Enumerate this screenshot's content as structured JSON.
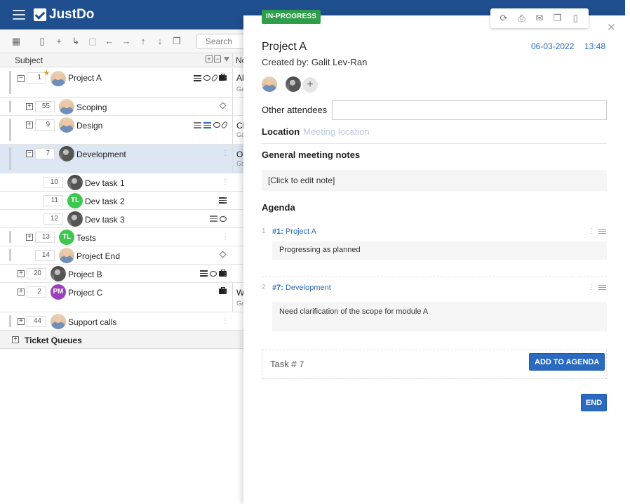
{
  "app": {
    "name": "JustDo"
  },
  "toolbar": {
    "search_placeholder": "Search"
  },
  "grid": {
    "header": {
      "subject": "Subject",
      "col2": "No"
    },
    "rows": [
      {
        "seq": "1",
        "title": "Project A",
        "col2_a": "Al",
        "col2_b": "Ga"
      },
      {
        "seq": "55",
        "title": "Scoping"
      },
      {
        "seq": "9",
        "title": "Design",
        "col2_a": "Cl",
        "col2_b": "Ga"
      },
      {
        "seq": "7",
        "title": "Development",
        "col2_a": "Oi",
        "col2_b": "Ga"
      },
      {
        "seq": "10",
        "title": "Dev task 1"
      },
      {
        "seq": "11",
        "title": "Dev task 2",
        "avatar": "TL"
      },
      {
        "seq": "12",
        "title": "Dev task 3"
      },
      {
        "seq": "13",
        "title": "Tests",
        "avatar": "TL"
      },
      {
        "seq": "14",
        "title": "Project End"
      },
      {
        "seq": "20",
        "title": "Project B"
      },
      {
        "seq": "2",
        "title": "Project C",
        "avatar": "PM",
        "col2_a": "W",
        "col2_b": "Ga"
      },
      {
        "seq": "44",
        "title": "Support calls"
      }
    ],
    "ticket_queues": "Ticket Queues"
  },
  "panel": {
    "status": "IN-PROGRESS",
    "title": "Project A",
    "date": "06-03-2022",
    "time": "13:48",
    "created_by": "Created by: Galit Lev-Ran",
    "other_attendees_label": "Other attendees",
    "location_label": "Location",
    "location_placeholder": "Meeting location",
    "notes_label": "General meeting notes",
    "notes_value": "[Click to edit note]",
    "agenda_label": "Agenda",
    "agenda": [
      {
        "num": "1",
        "task_num": "#1:",
        "task_name": "Project A",
        "note": "Progressing as planned"
      },
      {
        "num": "2",
        "task_num": "#7:",
        "task_name": "Development",
        "note": "Need clarification of the scope for module A"
      }
    ],
    "add_task_label": "Task #",
    "add_task_value": "7",
    "add_button": "ADD TO AGENDA",
    "end_button": "END"
  }
}
